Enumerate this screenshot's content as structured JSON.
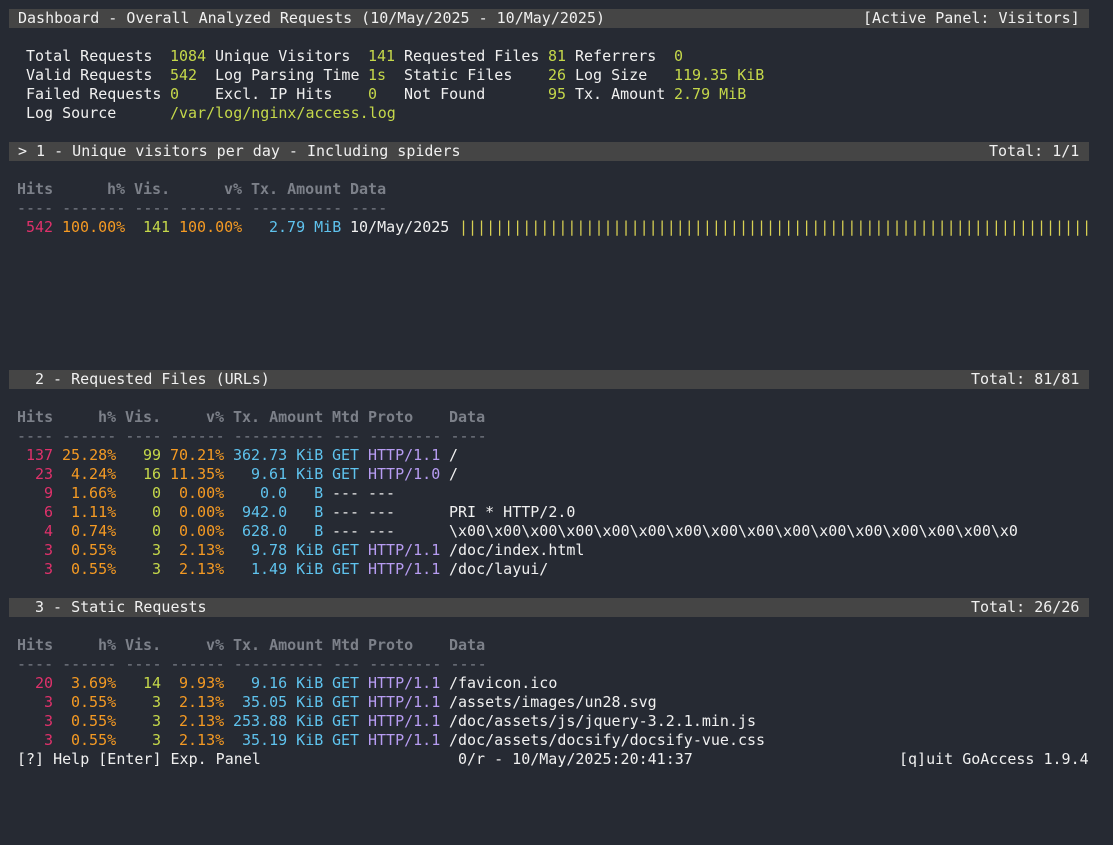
{
  "header": {
    "title": "Dashboard - Overall Analyzed Requests (10/May/2025 - 10/May/2025)",
    "active_panel": "[Active Panel: Visitors]"
  },
  "overall": {
    "total_requests_label": "Total Requests",
    "total_requests": "1084",
    "unique_visitors_label": "Unique Visitors",
    "unique_visitors": "141",
    "requested_files_label": "Requested Files",
    "requested_files": "81",
    "referrers_label": "Referrers",
    "referrers": "0",
    "valid_requests_label": "Valid Requests",
    "valid_requests": "542",
    "log_parsing_time_label": "Log Parsing Time",
    "log_parsing_time": "1s",
    "static_files_label": "Static Files",
    "static_files": "26",
    "log_size_label": "Log Size",
    "log_size": "119.35 KiB",
    "failed_requests_label": "Failed Requests",
    "failed_requests": "0",
    "excl_ip_hits_label": "Excl. IP Hits",
    "excl_ip_hits": "0",
    "not_found_label": "Not Found",
    "not_found": "95",
    "tx_amount_label": "Tx. Amount",
    "tx_amount": "2.79 MiB",
    "log_source_label": "Log Source",
    "log_source": "/var/log/nginx/access.log"
  },
  "panel1": {
    "title": "> 1 - Unique visitors per day - Including spiders",
    "total": "Total: 1/1",
    "headers": {
      "hits": "Hits",
      "hp": "h%",
      "vis": "Vis.",
      "vp": "v%",
      "tx": "Tx. Amount",
      "data": "Data"
    },
    "dashes": "---- ------- ---- ------- ---------- ----",
    "row": {
      "hits": "542",
      "hp": "100.00%",
      "vis": "141",
      "vp": "100.00%",
      "tx": "2.79 MiB",
      "data": "10/May/2025",
      "bar": "|||||||||||||||||||||||||||||||||||||||||||||||||||||||||||||||||||||||||",
      "bar_fill": 1.0
    }
  },
  "panel2": {
    "title": "2 - Requested Files (URLs)",
    "total": "Total: 81/81",
    "headers": {
      "hits": "Hits",
      "hp": "h%",
      "vis": "Vis.",
      "vp": "v%",
      "tx": "Tx. Amount",
      "mtd": "Mtd",
      "proto": "Proto",
      "data": "Data"
    },
    "dashes": "---- ------ ---- ------ ---------- --- -------- ----",
    "rows": [
      {
        "hits": "137",
        "hp": "25.28%",
        "vis": "99",
        "vp": "70.21%",
        "tx": "362.73 KiB",
        "mtd": "GET",
        "proto": "HTTP/1.1",
        "data": "/"
      },
      {
        "hits": "23",
        "hp": "4.24%",
        "vis": "16",
        "vp": "11.35%",
        "tx": "9.61 KiB",
        "mtd": "GET",
        "proto": "HTTP/1.0",
        "data": "/"
      },
      {
        "hits": "9",
        "hp": "1.66%",
        "vis": "0",
        "vp": "0.00%",
        "tx": "0.0   B",
        "mtd": "---",
        "proto": "---",
        "data": ""
      },
      {
        "hits": "6",
        "hp": "1.11%",
        "vis": "0",
        "vp": "0.00%",
        "tx": "942.0   B",
        "mtd": "---",
        "proto": "---",
        "data": "PRI * HTTP/2.0"
      },
      {
        "hits": "4",
        "hp": "0.74%",
        "vis": "0",
        "vp": "0.00%",
        "tx": "628.0   B",
        "mtd": "---",
        "proto": "---",
        "data": "\\x00\\x00\\x00\\x00\\x00\\x00\\x00\\x00\\x00\\x00\\x00\\x00\\x00\\x00\\x00\\x0"
      },
      {
        "hits": "3",
        "hp": "0.55%",
        "vis": "3",
        "vp": "2.13%",
        "tx": "9.78 KiB",
        "mtd": "GET",
        "proto": "HTTP/1.1",
        "data": "/doc/index.html"
      },
      {
        "hits": "3",
        "hp": "0.55%",
        "vis": "3",
        "vp": "2.13%",
        "tx": "1.49 KiB",
        "mtd": "GET",
        "proto": "HTTP/1.1",
        "data": "/doc/layui/"
      }
    ]
  },
  "panel3": {
    "title": "3 - Static Requests",
    "total": "Total: 26/26",
    "headers": {
      "hits": "Hits",
      "hp": "h%",
      "vis": "Vis.",
      "vp": "v%",
      "tx": "Tx. Amount",
      "mtd": "Mtd",
      "proto": "Proto",
      "data": "Data"
    },
    "dashes": "---- ------ ---- ------ ---------- --- -------- ----",
    "rows": [
      {
        "hits": "20",
        "hp": "3.69%",
        "vis": "14",
        "vp": "9.93%",
        "tx": "9.16 KiB",
        "mtd": "GET",
        "proto": "HTTP/1.1",
        "data": "/favicon.ico"
      },
      {
        "hits": "3",
        "hp": "0.55%",
        "vis": "3",
        "vp": "2.13%",
        "tx": "35.05 KiB",
        "mtd": "GET",
        "proto": "HTTP/1.1",
        "data": "/assets/images/un28.svg"
      },
      {
        "hits": "3",
        "hp": "0.55%",
        "vis": "3",
        "vp": "2.13%",
        "tx": "253.88 KiB",
        "mtd": "GET",
        "proto": "HTTP/1.1",
        "data": "/doc/assets/js/jquery-3.2.1.min.js"
      },
      {
        "hits": "3",
        "hp": "0.55%",
        "vis": "3",
        "vp": "2.13%",
        "tx": "35.19 KiB",
        "mtd": "GET",
        "proto": "HTTP/1.1",
        "data": "/doc/assets/docsify/docsify-vue.css"
      }
    ]
  },
  "footer": {
    "help": "[?] Help [Enter] Exp. Panel",
    "status": "0/r - 10/May/2025:20:41:37",
    "quit": "[q]uit GoAccess 1.9.4"
  },
  "colors": {
    "background": "#262a33",
    "panel_bar": "#454545",
    "text": "#f0f0f0",
    "green": "#c5d84a",
    "orange": "#f59a23",
    "red": "#e0316b",
    "blue": "#5fc3ee",
    "purple": "#b79cf2",
    "yellow": "#d7cf52",
    "dim": "#7c8089"
  }
}
